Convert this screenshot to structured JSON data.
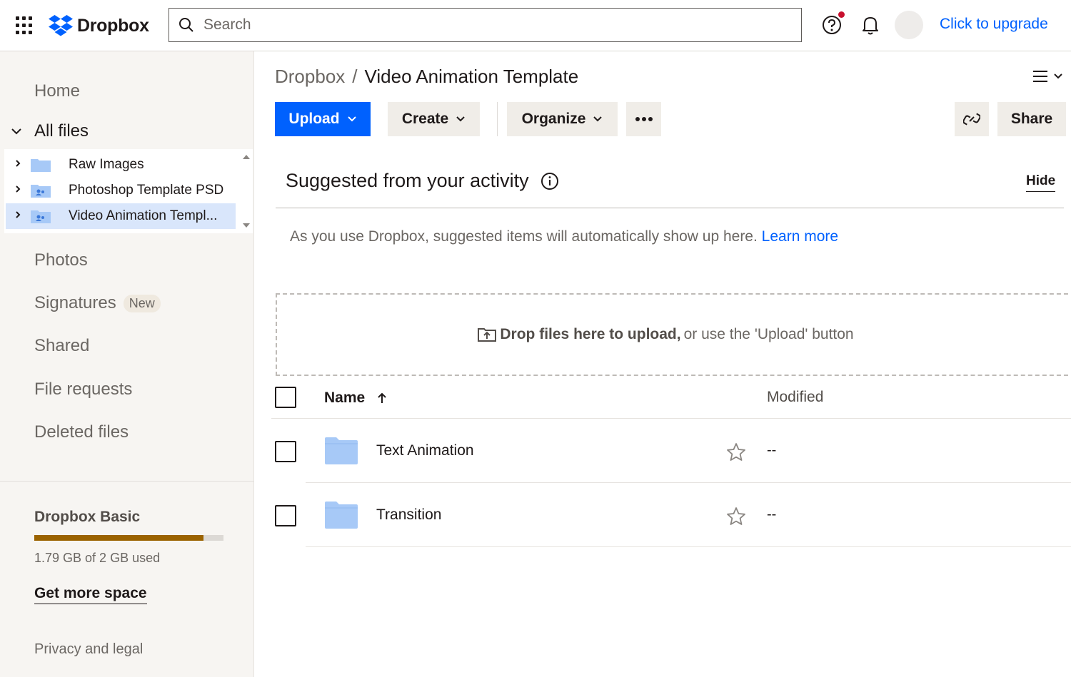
{
  "app": {
    "logo_text": "Dropbox",
    "search_placeholder": "Search",
    "upgrade_label": "Click to upgrade"
  },
  "sidebar": {
    "home": "Home",
    "all_files": "All files",
    "tree": [
      {
        "label": "Raw Images",
        "selected": false
      },
      {
        "label": "Photoshop Template PSD",
        "selected": false
      },
      {
        "label": "Video Animation Templ...",
        "selected": true
      }
    ],
    "photos": "Photos",
    "signatures": "Signatures",
    "signatures_badge": "New",
    "shared": "Shared",
    "file_requests": "File requests",
    "deleted_files": "Deleted files",
    "plan_name": "Dropbox Basic",
    "usage_fraction": 0.895,
    "usage_text": "1.79 GB of 2 GB used",
    "get_more_space": "Get more space",
    "privacy": "Privacy and legal"
  },
  "main": {
    "breadcrumb_root": "Dropbox",
    "breadcrumb_sep": "/",
    "breadcrumb_current": "Video Animation Template",
    "toolbar": {
      "upload": "Upload",
      "create": "Create",
      "organize": "Organize",
      "share": "Share"
    },
    "suggested": {
      "title": "Suggested from your activity",
      "hide": "Hide",
      "text": "As you use Dropbox, suggested items will automatically show up here.",
      "learn_more": "Learn more"
    },
    "dropzone": {
      "bold": "Drop files here to upload,",
      "rest": "or use the 'Upload' button"
    },
    "table": {
      "col_name": "Name",
      "col_modified": "Modified",
      "rows": [
        {
          "name": "Text Animation",
          "modified": "--"
        },
        {
          "name": "Transition",
          "modified": "--"
        }
      ]
    }
  },
  "colors": {
    "accent": "#0061fe",
    "folder": "#a7c9f7",
    "usage": "#9b6300"
  }
}
